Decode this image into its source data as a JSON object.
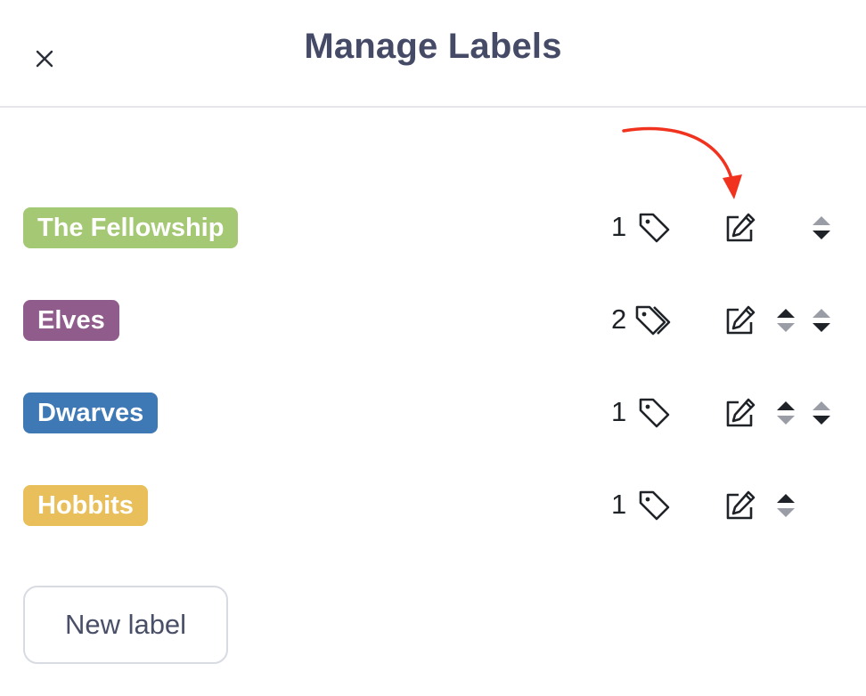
{
  "dialog": {
    "title": "Manage Labels",
    "close_icon": "close-icon"
  },
  "labels": [
    {
      "name": "The Fellowship",
      "color": "#a4c874",
      "count": "1",
      "tag_icon": "tag-icon",
      "can_move_up": false,
      "can_move_down": true
    },
    {
      "name": "Elves",
      "color": "#905c8c",
      "count": "2",
      "tag_icon": "tags-icon",
      "can_move_up": true,
      "can_move_down": true
    },
    {
      "name": "Dwarves",
      "color": "#3f79b5",
      "count": "1",
      "tag_icon": "tag-icon",
      "can_move_up": true,
      "can_move_down": true
    },
    {
      "name": "Hobbits",
      "color": "#e9bf5c",
      "count": "1",
      "tag_icon": "tag-icon",
      "can_move_up": true,
      "can_move_down": false
    }
  ],
  "actions": {
    "new_label": "New label"
  },
  "annotation": {
    "arrow_color": "#f0321e"
  }
}
